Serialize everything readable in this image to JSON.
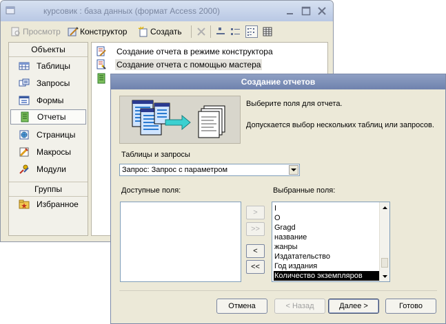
{
  "db_window": {
    "title": "курсовик : база данных (формат Access 2000)",
    "toolbar": {
      "preview_label": "Просмотр",
      "design_label": "Конструктор",
      "create_label": "Создать"
    },
    "sidebar": {
      "objects_header": "Объекты",
      "items": [
        {
          "label": "Таблицы",
          "icon": "table-icon"
        },
        {
          "label": "Запросы",
          "icon": "query-icon"
        },
        {
          "label": "Формы",
          "icon": "form-icon"
        },
        {
          "label": "Отчеты",
          "icon": "report-icon",
          "selected": true
        },
        {
          "label": "Страницы",
          "icon": "page-icon"
        },
        {
          "label": "Макросы",
          "icon": "macro-icon"
        },
        {
          "label": "Модули",
          "icon": "module-icon"
        }
      ],
      "groups_header": "Группы",
      "groups": [
        {
          "label": "Избранное",
          "icon": "favorites-icon"
        }
      ]
    },
    "objects": [
      {
        "label": "Создание отчета в режиме конструктора"
      },
      {
        "label": "Создание отчета с помощью мастера"
      },
      {
        "label": ""
      }
    ]
  },
  "dialog": {
    "title": "Создание отчетов",
    "instruction": "Выберите поля для отчета.",
    "hint": "Допускается выбор нескольких таблиц или запросов.",
    "tables_label": "Таблицы и запросы",
    "combo_value": "Запрос: Запрос с параметром",
    "available_label": "Доступные поля:",
    "available_fields": [],
    "selected_label": "Выбранные поля:",
    "selected_fields": [
      "I",
      "O",
      "Gragd",
      "название",
      "жанры",
      "Издатательство",
      "Год издания",
      "Количество экземпляров"
    ],
    "selected_highlight_index": 7,
    "move_buttons": [
      ">",
      ">>",
      "<",
      "<<"
    ],
    "buttons": {
      "cancel": "Отмена",
      "back": "< Назад",
      "next": "Далее >",
      "finish": "Готово"
    }
  }
}
